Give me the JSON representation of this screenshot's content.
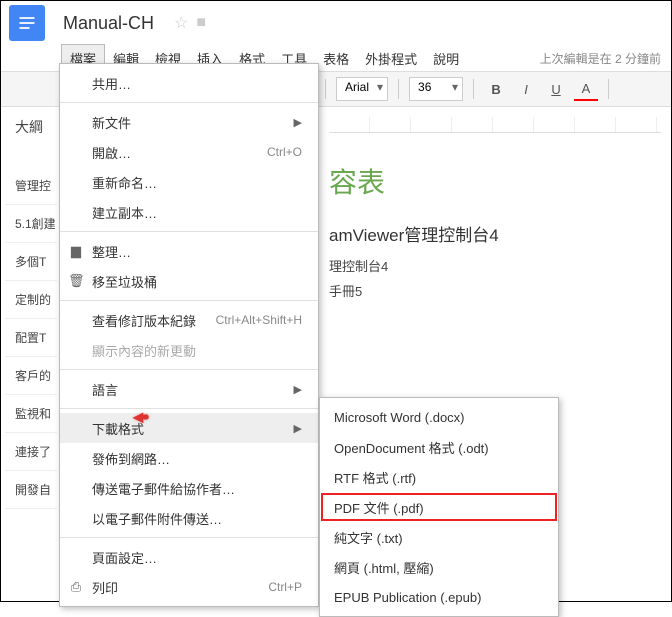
{
  "header": {
    "doc_title": "Manual-CH",
    "last_edit": "上次編輯是在 2 分鐘前"
  },
  "menu": {
    "items": [
      "檔案",
      "編輯",
      "檢視",
      "插入",
      "格式",
      "工具",
      "表格",
      "外掛程式",
      "說明"
    ],
    "active_index": 0
  },
  "toolbar": {
    "font_name": "Arial",
    "font_size": "36"
  },
  "outline": {
    "title": "大綱",
    "items": [
      "管理控",
      "5.1創建",
      "多個T",
      "定制的",
      "配置T",
      "客戶的",
      "監視和",
      "連接了",
      "開發自"
    ]
  },
  "file_menu": {
    "share": "共用…",
    "new": "新文件",
    "open": "開啟…",
    "open_shortcut": "Ctrl+O",
    "rename": "重新命名…",
    "copy": "建立副本…",
    "organize": "整理…",
    "trash": "移至垃圾桶",
    "revision": "查看修訂版本紀錄",
    "revision_shortcut": "Ctrl+Alt+Shift+H",
    "show_updates": "顯示內容的新更動",
    "language": "語言",
    "download": "下載格式",
    "publish": "發佈到網路…",
    "email_collab": "傳送電子郵件給協作者…",
    "email_attach": "以電子郵件附件傳送…",
    "page_setup": "頁面設定…",
    "print": "列印",
    "print_shortcut": "Ctrl+P"
  },
  "download_submenu": {
    "items": [
      "Microsoft Word (.docx)",
      "OpenDocument 格式 (.odt)",
      "RTF 格式 (.rtf)",
      "PDF 文件 (.pdf)",
      "純文字 (.txt)",
      "網頁 (.html, 壓縮)",
      "EPUB Publication (.epub)"
    ],
    "highlighted_index": 3
  },
  "document": {
    "heading1_fragment": "容表",
    "heading2_fragment": "amViewer管理控制台4",
    "line1": "理控制台4",
    "line2": "手冊5"
  }
}
